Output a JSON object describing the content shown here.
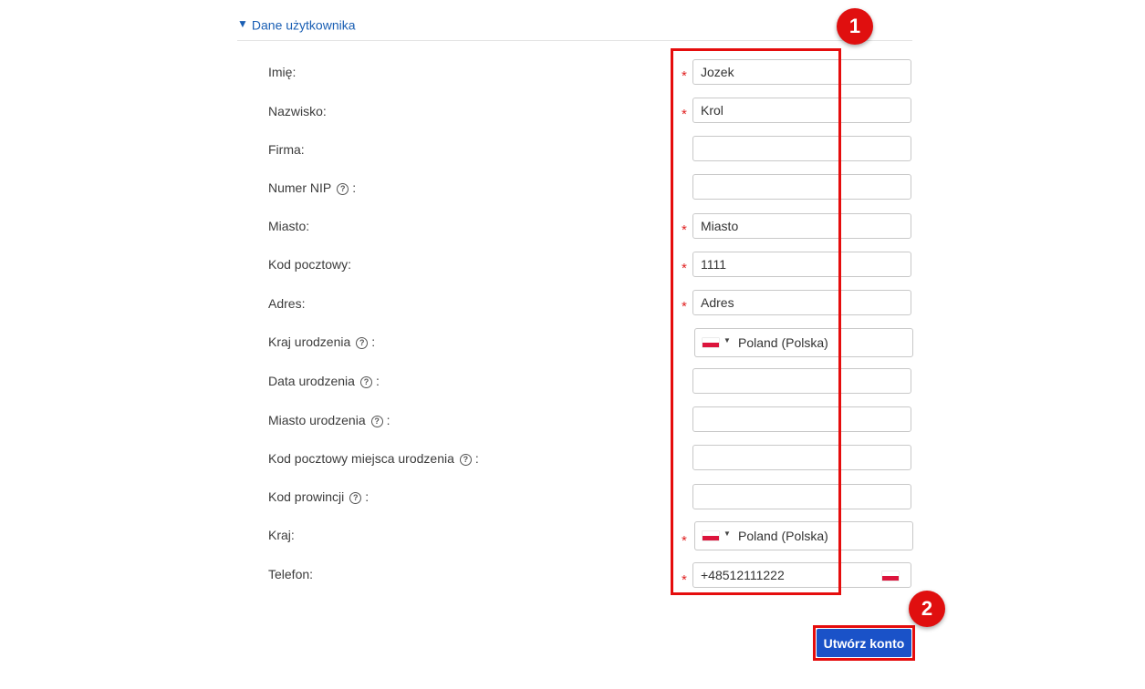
{
  "section": {
    "title": "Dane użytkownika",
    "caret_icon": "▼"
  },
  "fields": {
    "imie": {
      "label": "Imię:",
      "value": "Jozek"
    },
    "nazwisko": {
      "label": "Nazwisko:",
      "value": "Krol"
    },
    "firma": {
      "label": "Firma:",
      "value": ""
    },
    "nip": {
      "label": "Numer NIP",
      "suffix": ":",
      "value": ""
    },
    "miasto": {
      "label": "Miasto:",
      "value": "Miasto"
    },
    "kod_pocztowy": {
      "label": "Kod pocztowy:",
      "value": "1111"
    },
    "adres": {
      "label": "Adres:",
      "value": "Adres"
    },
    "kraj_urodzenia": {
      "label": "Kraj urodzenia",
      "suffix": ":",
      "value": "Poland (Polska)"
    },
    "data_urodzenia": {
      "label": "Data urodzenia",
      "suffix": ":",
      "value": ""
    },
    "miasto_urodzenia": {
      "label": "Miasto urodzenia",
      "suffix": ":",
      "value": ""
    },
    "kod_pocztowy_urodzenia": {
      "label": "Kod pocztowy miejsca urodzenia",
      "suffix": ":",
      "value": ""
    },
    "kod_prowincji": {
      "label": "Kod prowincji",
      "suffix": ":",
      "value": ""
    },
    "kraj": {
      "label": "Kraj:",
      "value": "Poland (Polska)"
    },
    "telefon": {
      "label": "Telefon:",
      "value": "+48512111222"
    }
  },
  "required_marker": "*",
  "help_icon": "?",
  "submit": {
    "label": "Utwórz konto"
  },
  "annotations": {
    "badge1": "1",
    "badge2": "2",
    "accent": "#e50d0d"
  },
  "colors": {
    "button": "#1a52c8",
    "link": "#1a5fb4",
    "required": "#e02020"
  }
}
